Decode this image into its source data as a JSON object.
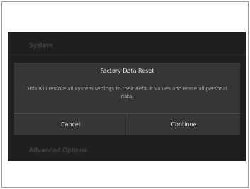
{
  "background": {
    "top_item": "System",
    "bottom_item": "Advanced Options"
  },
  "dialog": {
    "title": "Factory Data Reset",
    "message": "This will restore all system settings to their default values and erase all personal data.",
    "cancel_label": "Cancel",
    "continue_label": "Continue"
  },
  "colors": {
    "screen_bg": "#1f1f1f",
    "dialog_bg": "#363636",
    "text_primary": "#e0e0e0",
    "text_secondary": "#a8a8a8"
  }
}
